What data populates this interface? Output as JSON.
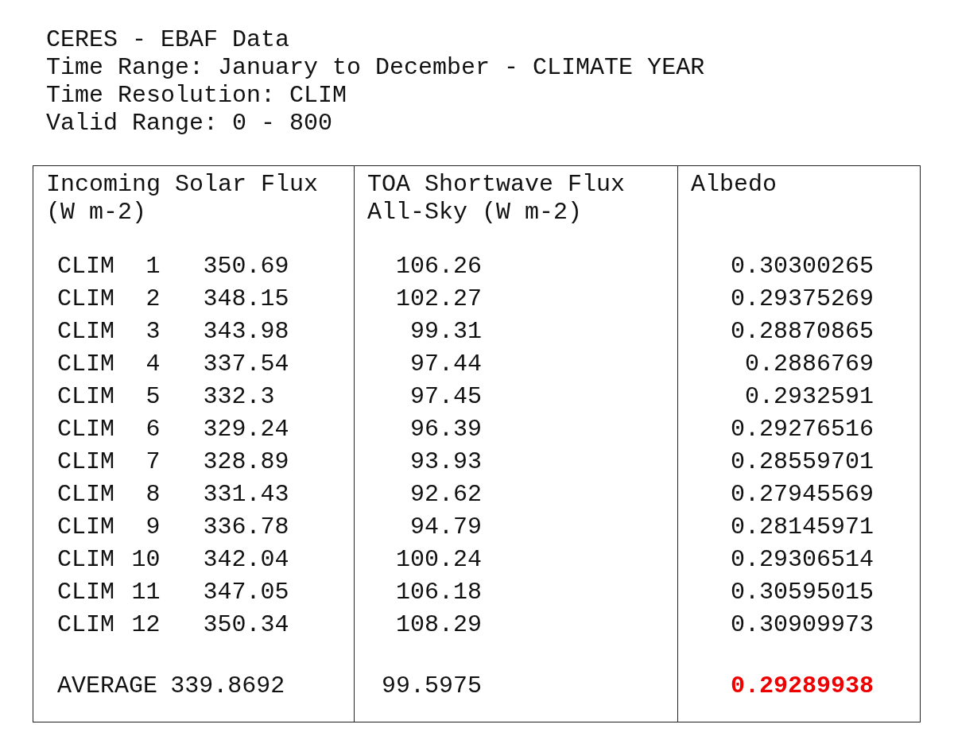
{
  "header_lines": [
    "CERES - EBAF Data",
    "Time Range: January to December - CLIMATE YEAR",
    "Time Resolution: CLIM",
    "Valid Range: 0 - 800"
  ],
  "columns": [
    {
      "lines": [
        "Incoming Solar Flux",
        "(W m-2)"
      ]
    },
    {
      "lines": [
        "TOA Shortwave Flux",
        "All-Sky (W m-2)"
      ]
    },
    {
      "lines": [
        "Albedo"
      ]
    }
  ],
  "rows": [
    {
      "label": "CLIM",
      "index": "1",
      "incoming": "350.69",
      "toa": "106.26",
      "albedo": "0.30300265"
    },
    {
      "label": "CLIM",
      "index": "2",
      "incoming": "348.15",
      "toa": "102.27",
      "albedo": "0.29375269"
    },
    {
      "label": "CLIM",
      "index": "3",
      "incoming": "343.98",
      "toa": "99.31",
      "albedo": "0.28870865"
    },
    {
      "label": "CLIM",
      "index": "4",
      "incoming": "337.54",
      "toa": "97.44",
      "albedo": "0.2886769"
    },
    {
      "label": "CLIM",
      "index": "5",
      "incoming": "332.3",
      "toa": "97.45",
      "albedo": "0.2932591"
    },
    {
      "label": "CLIM",
      "index": "6",
      "incoming": "329.24",
      "toa": "96.39",
      "albedo": "0.29276516"
    },
    {
      "label": "CLIM",
      "index": "7",
      "incoming": "328.89",
      "toa": "93.93",
      "albedo": "0.28559701"
    },
    {
      "label": "CLIM",
      "index": "8",
      "incoming": "331.43",
      "toa": "92.62",
      "albedo": "0.27945569"
    },
    {
      "label": "CLIM",
      "index": "9",
      "incoming": "336.78",
      "toa": "94.79",
      "albedo": "0.28145971"
    },
    {
      "label": "CLIM",
      "index": "10",
      "incoming": "342.04",
      "toa": "100.24",
      "albedo": "0.29306514"
    },
    {
      "label": "CLIM",
      "index": "11",
      "incoming": "347.05",
      "toa": "106.18",
      "albedo": "0.30595015"
    },
    {
      "label": "CLIM",
      "index": "12",
      "incoming": "350.34",
      "toa": "108.29",
      "albedo": "0.30909973"
    }
  ],
  "average": {
    "label": "AVERAGE",
    "incoming": "339.8692",
    "toa": "99.5975",
    "albedo": "0.29289938",
    "albedo_highlighted": true
  }
}
